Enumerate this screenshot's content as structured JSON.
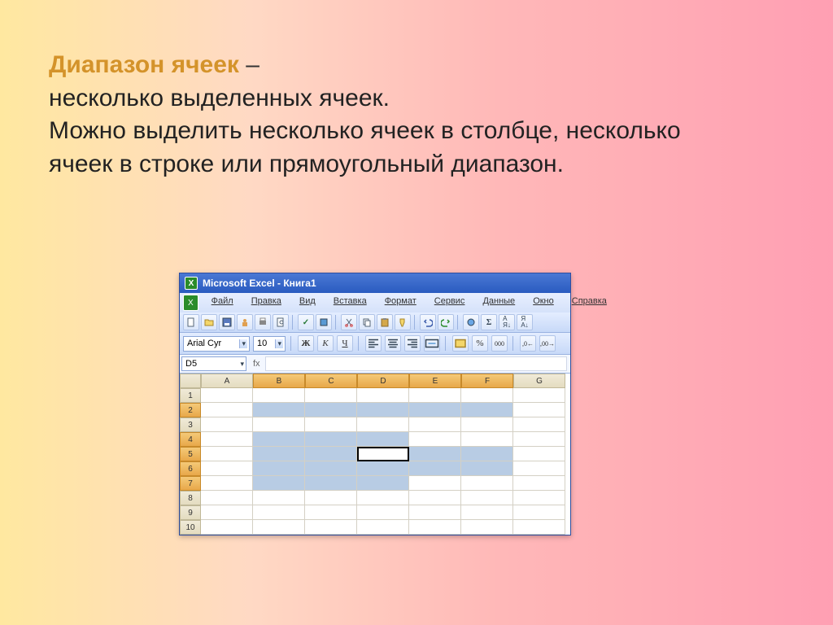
{
  "heading": {
    "term": "Диапазон ячеек",
    "dash": " – ",
    "line1": "несколько выделенных ячеек.",
    "line2": "Можно выделить несколько ячеек в столбце, несколько ячеек в строке или прямоугольный диапазон."
  },
  "window": {
    "title": "Microsoft Excel - Книга1"
  },
  "menus": {
    "file": "Файл",
    "edit": "Правка",
    "view": "Вид",
    "insert": "Вставка",
    "format": "Формат",
    "tools": "Сервис",
    "data": "Данные",
    "window": "Окно",
    "help": "Справка"
  },
  "format": {
    "font": "Arial Cyr",
    "size": "10",
    "bold": "Ж",
    "italic": "К",
    "underline": "Ч",
    "percent": "%",
    "thousand": "000"
  },
  "namebox": "D5",
  "fx": "fx",
  "columns": [
    "A",
    "B",
    "C",
    "D",
    "E",
    "F",
    "G"
  ],
  "rows": [
    "1",
    "2",
    "3",
    "4",
    "5",
    "6",
    "7",
    "8",
    "9",
    "10"
  ],
  "selected_row_headers": [
    2,
    4,
    5,
    6,
    7
  ],
  "selected_col_headers": [
    "B",
    "C",
    "D",
    "E",
    "F"
  ],
  "active_cell": "D5"
}
